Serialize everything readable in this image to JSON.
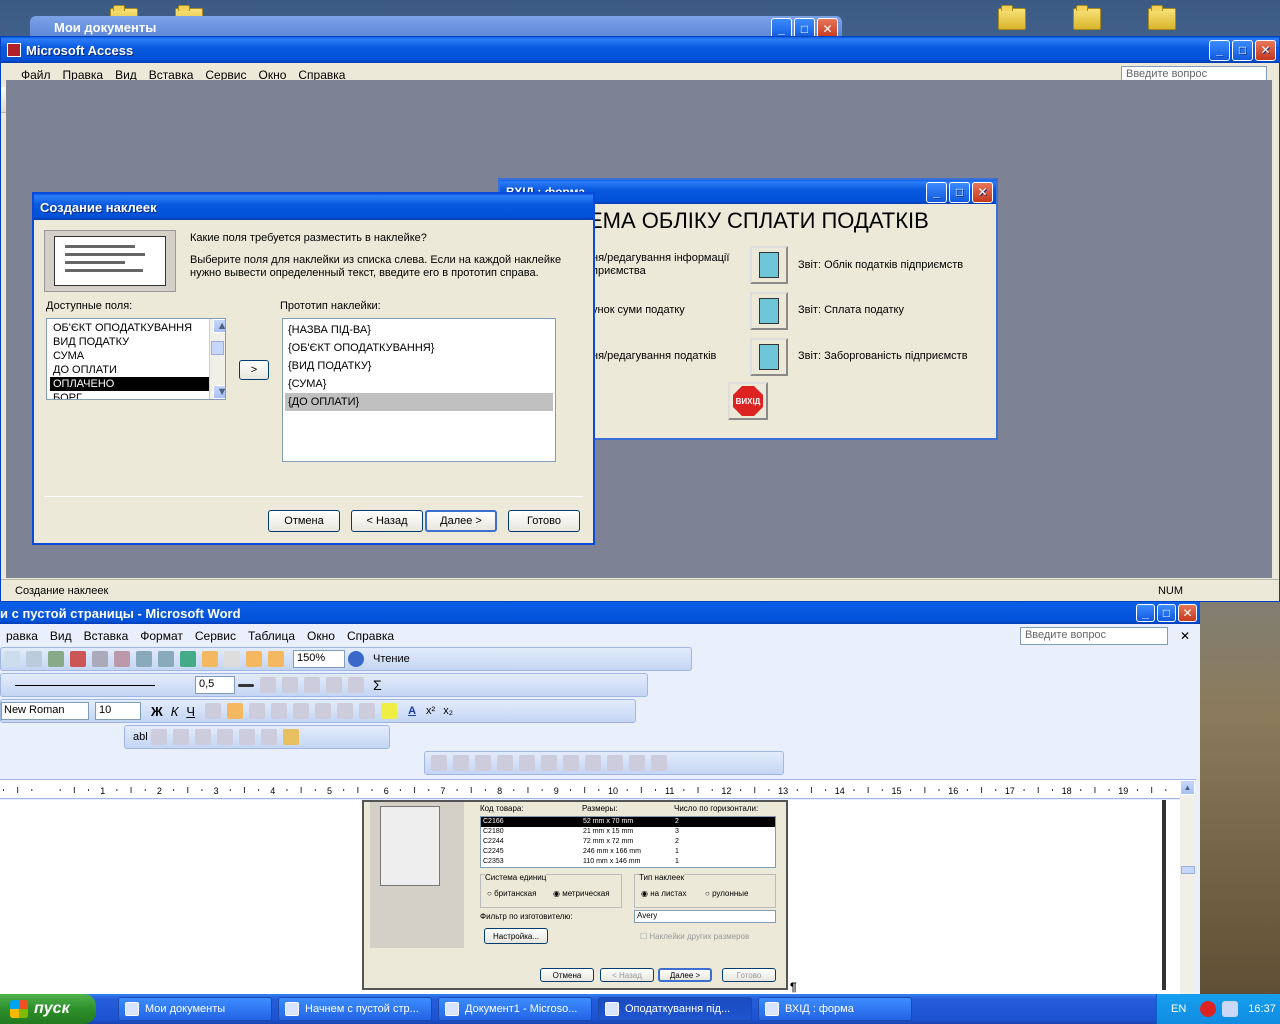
{
  "desktop": {
    "mydocs_title": "Мои документы"
  },
  "access": {
    "title": "Microsoft Access",
    "menu": [
      "Файл",
      "Правка",
      "Вид",
      "Вставка",
      "Сервис",
      "Окно",
      "Справка"
    ],
    "ask_placeholder": "Введите вопрос",
    "status_text": "Создание наклеек",
    "status_num": "NUM"
  },
  "form": {
    "title": "ВХІД : форма",
    "heading": "ЕМА ОБЛІКУ СПЛАТИ ПОДАТКІВ",
    "left_items": [
      "ня/редагування інформації\nприємства",
      "унок суми податку",
      "ня/редагування податків"
    ],
    "right_items": [
      "Звіт: Облік податків підприємств",
      "Звіт: Сплата податку",
      "Звіт: Заборгованість підприємств"
    ],
    "exit_label": "ВИХІД"
  },
  "wizard": {
    "title": "Создание наклеек",
    "question": "Какие поля требуется разместить в наклейке?",
    "instruction": "Выберите поля для наклейки из списка слева. Если на каждой наклейке нужно вывести определенный текст, введите его в прототип справа.",
    "available_label": "Доступные поля:",
    "prototype_label": "Прототип наклейки:",
    "available_fields": [
      "ОБ'ЄКТ ОПОДАТКУВАННЯ",
      "ВИД ПОДАТКУ",
      "СУМА",
      "ДО ОПЛАТИ",
      "ОПЛАЧЕНО",
      "БОРГ"
    ],
    "selected_field_index": 4,
    "prototype_lines": [
      "{НАЗВА ПІД-ВА}",
      "{ОБ'ЄКТ ОПОДАТКУВАННЯ}",
      "{ВИД ПОДАТКУ}",
      "{СУМА}",
      "{ДО ОПЛАТИ}"
    ],
    "move_label": ">",
    "buttons": {
      "cancel": "Отмена",
      "back": "< Назад",
      "next": "Далее >",
      "finish": "Готово"
    }
  },
  "word": {
    "title": "и с пустой страницы - Microsoft Word",
    "menu": [
      "равка",
      "Вид",
      "Вставка",
      "Формат",
      "Сервис",
      "Таблица",
      "Окно",
      "Справка"
    ],
    "ask_placeholder": "Введите вопрос",
    "zoom": "150%",
    "reading": "Чтение",
    "line_width": "0,5",
    "font_name": "New Roman",
    "font_size": "10",
    "ruler_numbers": [
      "1",
      "1",
      "2",
      "3",
      "4",
      "5",
      "6",
      "7",
      "8",
      "9",
      "10",
      "11",
      "12",
      "13",
      "14",
      "15",
      "16",
      "17",
      "18",
      "19"
    ],
    "label_dialog": {
      "headers": [
        "Код товара:",
        "Размеры:",
        "Число по горизонтали:"
      ],
      "rows": [
        [
          "C2166",
          "52 mm x 70 mm",
          "2"
        ],
        [
          "C2180",
          "21 mm x 15 mm",
          "3"
        ],
        [
          "C2244",
          "72 mm x 72 mm",
          "2"
        ],
        [
          "C2245",
          "246 mm x 166 mm",
          "1"
        ],
        [
          "C2353",
          "110 mm x 146 mm",
          "1"
        ]
      ],
      "units_label": "Система единиц",
      "unit_brit": "британская",
      "unit_metric": "метрическая",
      "type_label": "Тип наклеек",
      "type_sheet": "на листах",
      "type_roll": "рулонные",
      "filter_label": "Фильтр по изготовителю:",
      "filter_value": "Avery",
      "setup_button": "Настройка...",
      "other_sizes": "Наклейки других размеров",
      "buttons": {
        "cancel": "Отмена",
        "back": "< Назад",
        "next": "Далее >",
        "finish": "Готово"
      }
    }
  },
  "taskbar": {
    "start": "пуск",
    "items": [
      "Мои документы",
      "Начнем с пустой стр...",
      "Документ1 - Microso...",
      "Оподаткування під...",
      "ВХІД : форма"
    ],
    "active_index": 3,
    "lang": "EN",
    "clock": "16:37"
  }
}
